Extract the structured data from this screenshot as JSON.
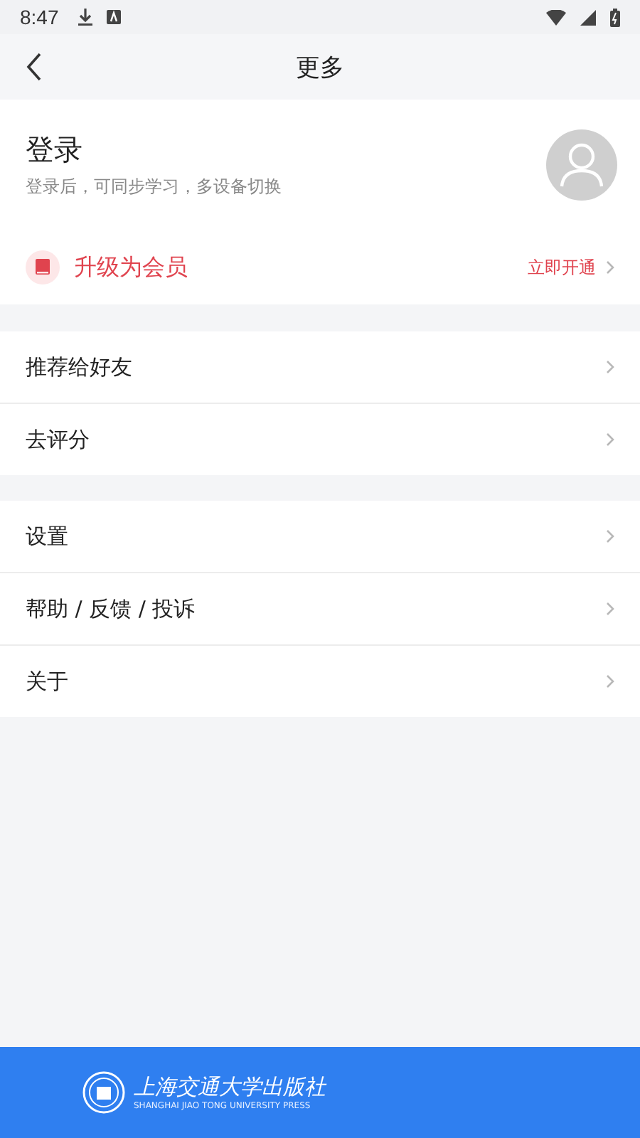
{
  "status_bar": {
    "time": "8:47"
  },
  "header": {
    "title": "更多"
  },
  "login": {
    "title": "登录",
    "subtitle": "登录后，可同步学习，多设备切换"
  },
  "membership": {
    "label": "升级为会员",
    "action": "立即开通"
  },
  "groups": [
    {
      "items": [
        {
          "label": "推荐给好友"
        },
        {
          "label": "去评分"
        }
      ]
    },
    {
      "items": [
        {
          "label": "设置"
        },
        {
          "label": "帮助 / 反馈 / 投诉"
        },
        {
          "label": "关于"
        }
      ]
    }
  ],
  "banner": {
    "name": "上海交通大学出版社",
    "name_en": "SHANGHAI JIAO TONG UNIVERSITY PRESS"
  }
}
